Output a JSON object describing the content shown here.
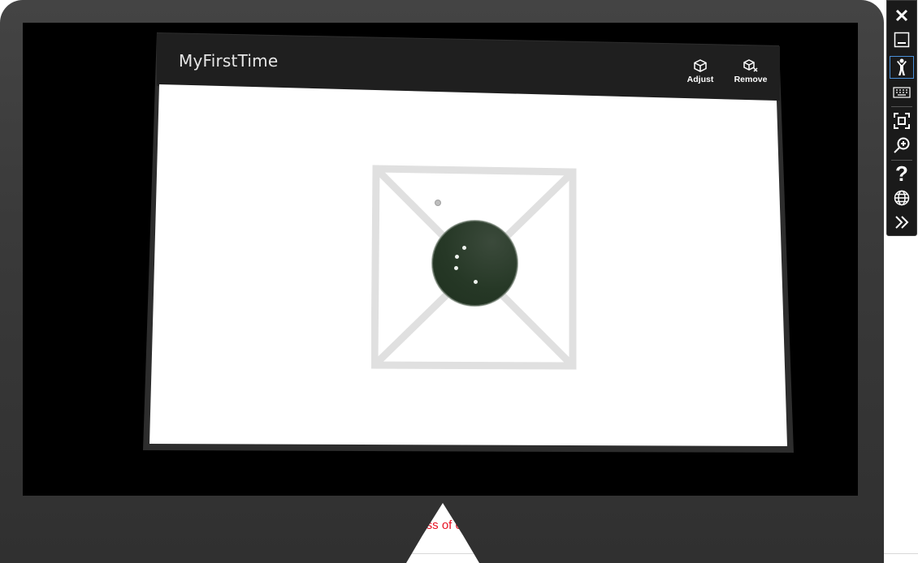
{
  "background": {
    "red_text_left": "loss of c",
    "red_text_right": ".",
    "red_color": "#e81123"
  },
  "app": {
    "title": "MyFirstTime",
    "toolbar": {
      "adjust_label": "Adjust",
      "remove_label": "Remove"
    }
  },
  "side_toolbar": {
    "items": [
      {
        "icon": "close-icon"
      },
      {
        "icon": "minimize-icon"
      },
      {
        "icon": "person-icon",
        "active": true
      },
      {
        "icon": "keyboard-icon"
      },
      {
        "icon": "fit-screen-icon"
      },
      {
        "icon": "zoom-icon"
      },
      {
        "icon": "help-icon"
      },
      {
        "icon": "globe-icon"
      },
      {
        "icon": "expand-icon"
      }
    ],
    "active_color": "#4a90d9"
  }
}
